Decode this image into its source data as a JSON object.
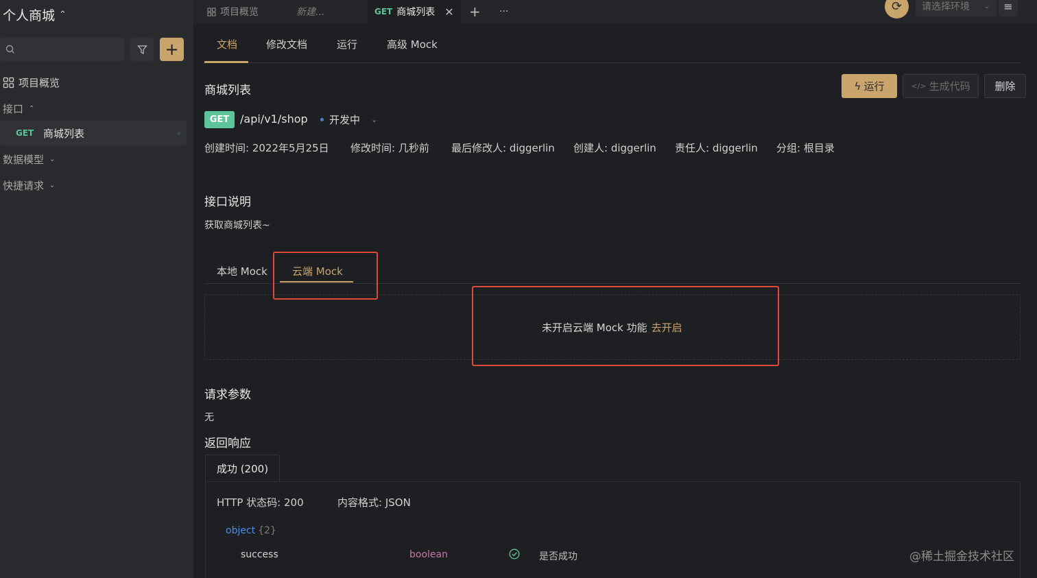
{
  "sidebar": {
    "project_name": "个人商城",
    "search_placeholder": "",
    "items": {
      "overview": "项目概览",
      "interfaces": "接口",
      "active_method": "GET",
      "active_name": "商城列表",
      "data_models": "数据模型",
      "quick_requests": "快捷请求"
    }
  },
  "topbar": {
    "tabs": [
      {
        "label": "项目概览",
        "icon": "grid-icon"
      },
      {
        "label": "新建..."
      },
      {
        "method": "GET",
        "label": "商城列表",
        "active": true
      }
    ],
    "add_tab": "+",
    "more": "···",
    "env_placeholder": "请选择环境"
  },
  "main": {
    "subtabs": [
      "文档",
      "修改文档",
      "运行",
      "高级 Mock"
    ],
    "api_title": "商城列表",
    "buttons": {
      "run": "运行",
      "gen_code": "生成代码",
      "delete": "删除"
    },
    "method": "GET",
    "path": "/api/v1/shop",
    "status": "开发中",
    "meta": [
      "创建时间: 2022年5月25日",
      "修改时间: 几秒前",
      "最后修改人: diggerlin",
      "创建人: diggerlin",
      "责任人: diggerlin",
      "分组: 根目录"
    ],
    "desc_title": "接口说明",
    "desc_text": "获取商城列表~",
    "mock_tabs": [
      "本地 Mock",
      "云端 Mock"
    ],
    "mock_message": "未开启云端 Mock 功能",
    "mock_link": "去开启",
    "params_title": "请求参数",
    "params_value": "无",
    "response_title": "返回响应",
    "response_tab": "成功 (200)",
    "http_status": "HTTP 状态码: 200",
    "content_type": "内容格式: JSON",
    "object_label": "object",
    "object_count": "{2}",
    "fields": [
      {
        "name": "success",
        "type": "boolean",
        "desc": "是否成功"
      }
    ]
  },
  "watermark": "@稀土掘金技术社区",
  "colors": {
    "accent": "#c9a56b",
    "get_method": "#5ec49a",
    "highlight": "#e04a3a",
    "object_keyword": "#4d8ee8",
    "type_color": "#c776a8"
  }
}
